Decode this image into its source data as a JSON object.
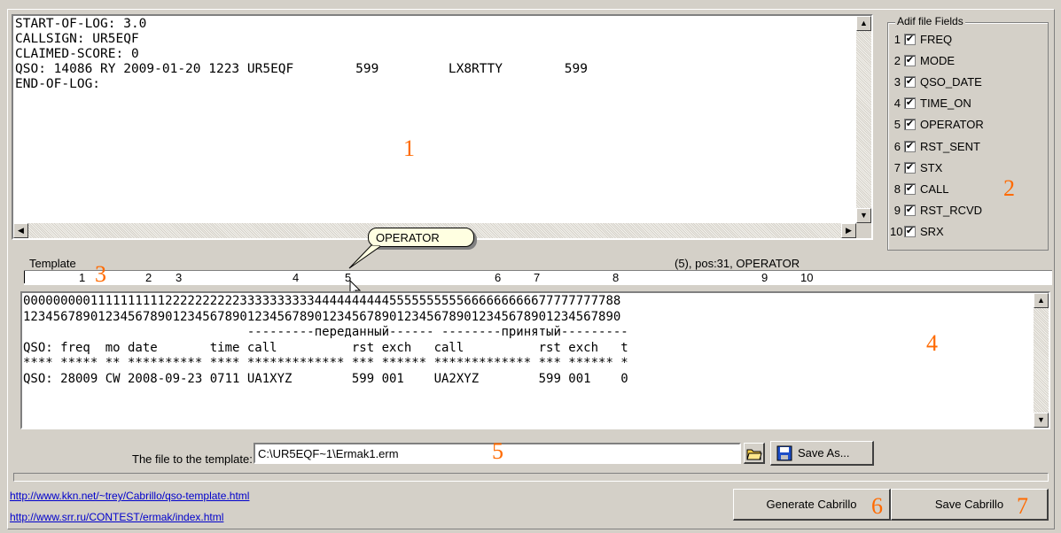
{
  "log_text": "START-OF-LOG: 3.0\nCALLSIGN: UR5EQF\nCLAIMED-SCORE: 0\nQSO: 14086 RY 2009-01-20 1223 UR5EQF        599         LX8RTTY        599\nEND-OF-LOG:",
  "markers": {
    "m1": "1",
    "m2": "2",
    "m3": "3",
    "m4": "4",
    "m5": "5",
    "m6": "6",
    "m7": "7"
  },
  "adif": {
    "title": "Adif file Fields",
    "fields": [
      {
        "n": "1",
        "name": "FREQ"
      },
      {
        "n": "2",
        "name": "MODE"
      },
      {
        "n": "3",
        "name": "QSO_DATE"
      },
      {
        "n": "4",
        "name": "TIME_ON"
      },
      {
        "n": "5",
        "name": "OPERATOR"
      },
      {
        "n": "6",
        "name": "RST_SENT"
      },
      {
        "n": "7",
        "name": "STX"
      },
      {
        "n": "8",
        "name": "CALL"
      },
      {
        "n": "9",
        "name": "RST_RCVD"
      },
      {
        "n": "10",
        "name": "SRX"
      }
    ],
    "checkmark": "✔"
  },
  "tooltip": "OPERATOR",
  "template": {
    "label": "Template",
    "status": "(5),  pos:31,  OPERATOR",
    "ruler": [
      "1",
      "2",
      "3",
      "4",
      "5",
      "6",
      "7",
      "8",
      "9",
      "10"
    ],
    "text": "00000000011111111112222222222333333333344444444445555555555666666666677777777788\n12345678901234567890123456789012345678901234567890123456789012345678901234567890\n                              ---------переданный------ --------принятый---------\nQSO: freq  mo date       time call          rst exch   call          rst exch   t\n**** ***** ** ********** **** ************* *** ****** ************* *** ****** *\nQSO: 28009 CW 2008-09-23 0711 UA1XYZ        599 001    UA2XYZ        599 001    0"
  },
  "file": {
    "label": "The file to the template:",
    "value": "C:\\UR5EQF~1\\Ermak1.erm",
    "save_as": "Save As..."
  },
  "links": [
    "http://www.kkn.net/~trey/Cabrillo/qso-template.html",
    "http://www.srr.ru/CONTEST/ermak/index.html"
  ],
  "buttons": {
    "generate": "Generate Cabrillo",
    "save": "Save Cabrillo"
  }
}
